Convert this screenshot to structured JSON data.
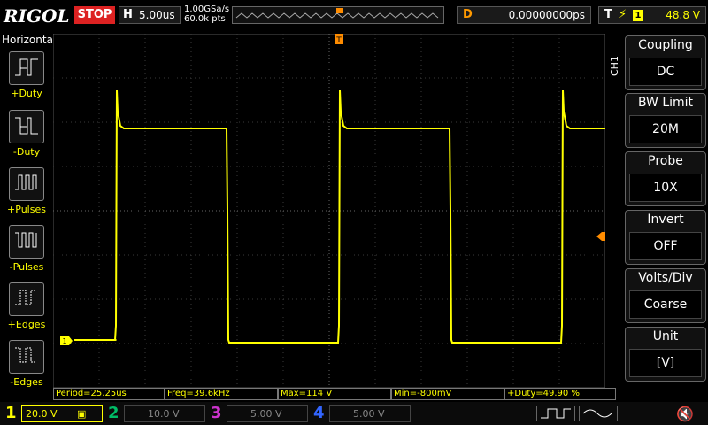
{
  "header": {
    "logo": "RIGOL",
    "run_state": "STOP",
    "horizontal_key": "H",
    "timebase": "5.00us",
    "sample_rate": "1.00GSa/s",
    "memory_depth": "60.0k pts",
    "delay_key": "D",
    "delay_value": "0.00000000ps",
    "trigger_key": "T",
    "trigger_channel": "1",
    "trigger_level": "48.8 V"
  },
  "left_panel": {
    "title": "Horizontal",
    "items": [
      {
        "label": "+Duty"
      },
      {
        "label": "-Duty"
      },
      {
        "label": "+Pulses"
      },
      {
        "label": "-Pulses"
      },
      {
        "label": "+Edges"
      },
      {
        "label": "-Edges"
      }
    ]
  },
  "right_panel": {
    "channel_tag": "CH1",
    "menus": [
      {
        "title": "Coupling",
        "value": "DC"
      },
      {
        "title": "BW Limit",
        "value": "20M"
      },
      {
        "title": "Probe",
        "value": "10X"
      },
      {
        "title": "Invert",
        "value": "OFF"
      },
      {
        "title": "Volts/Div",
        "value": "Coarse"
      },
      {
        "title": "Unit",
        "value": "[V]"
      }
    ]
  },
  "measurements": [
    {
      "text": "Period=25.25us"
    },
    {
      "text": "Freq=39.6kHz"
    },
    {
      "text": "Max=114 V"
    },
    {
      "text": "Min=-800mV"
    },
    {
      "text": "+Duty=49.90 %"
    }
  ],
  "channels": [
    {
      "num": "1",
      "scale": "20.0 V",
      "color": "#ffff00"
    },
    {
      "num": "2",
      "scale": "10.0 V",
      "color": "#00c8c8"
    },
    {
      "num": "3",
      "scale": "5.00 V",
      "color": "#e040e0"
    },
    {
      "num": "4",
      "scale": "5.00 V",
      "color": "#3a7fff"
    }
  ],
  "markers": {
    "trigger_pos": "T",
    "ch1_ground": "1"
  },
  "colors": {
    "ch1": "#ffff00",
    "trigger": "#ff8c00",
    "stop": "#dd2222"
  }
}
